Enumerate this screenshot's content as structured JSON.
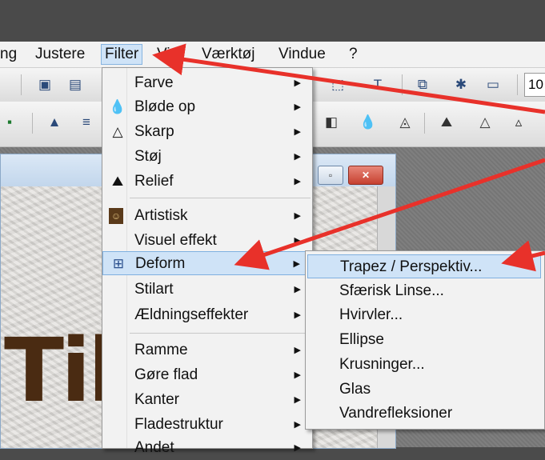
{
  "menubar": {
    "items": [
      {
        "label": "ng"
      },
      {
        "label": "Justere"
      },
      {
        "label": "Filter"
      },
      {
        "label": "Vis"
      },
      {
        "label": "Værktøj"
      },
      {
        "label": "Vindue"
      },
      {
        "label": "?"
      }
    ]
  },
  "toolbar": {
    "zoom_partial": "10"
  },
  "filter_menu": {
    "items": [
      {
        "label": "Farve",
        "icon": "none",
        "has_submenu": true
      },
      {
        "label": "Bløde op",
        "icon": "drop-icon",
        "has_submenu": true
      },
      {
        "label": "Skarp",
        "icon": "triangle-icon",
        "has_submenu": true
      },
      {
        "label": "Støj",
        "icon": "none",
        "has_submenu": true
      },
      {
        "label": "Relief",
        "icon": "relief-icon",
        "has_submenu": true
      },
      {
        "label": "Artistisk",
        "icon": "mona-lisa-icon",
        "has_submenu": true
      },
      {
        "label": "Visuel effekt",
        "icon": "none",
        "has_submenu": true
      },
      {
        "label": "Deform",
        "icon": "grid-deform-icon",
        "has_submenu": true,
        "highlighted": true
      },
      {
        "label": "Stilart",
        "icon": "none",
        "has_submenu": true
      },
      {
        "label": "Ældningseffekter",
        "icon": "none",
        "has_submenu": true
      },
      {
        "label": "Ramme",
        "icon": "none",
        "has_submenu": true
      },
      {
        "label": "Gøre flad",
        "icon": "none",
        "has_submenu": true
      },
      {
        "label": "Kanter",
        "icon": "none",
        "has_submenu": true
      },
      {
        "label": "Fladestruktur",
        "icon": "none",
        "has_submenu": true
      },
      {
        "label": "Andet",
        "icon": "none",
        "has_submenu": true
      }
    ]
  },
  "deform_submenu": {
    "items": [
      {
        "label": "Trapez / Perspektiv...",
        "highlighted": true
      },
      {
        "label": "Sfærisk Linse..."
      },
      {
        "label": "Hvirvler..."
      },
      {
        "label": "Ellipse"
      },
      {
        "label": "Krusninger..."
      },
      {
        "label": "Glas"
      },
      {
        "label": "Vandrefleksioner"
      }
    ]
  },
  "canvas": {
    "text": "Til"
  },
  "colors": {
    "arrow": "#e8312a",
    "highlight": "#cfe3f7",
    "canvas_text": "#4a2b12"
  }
}
